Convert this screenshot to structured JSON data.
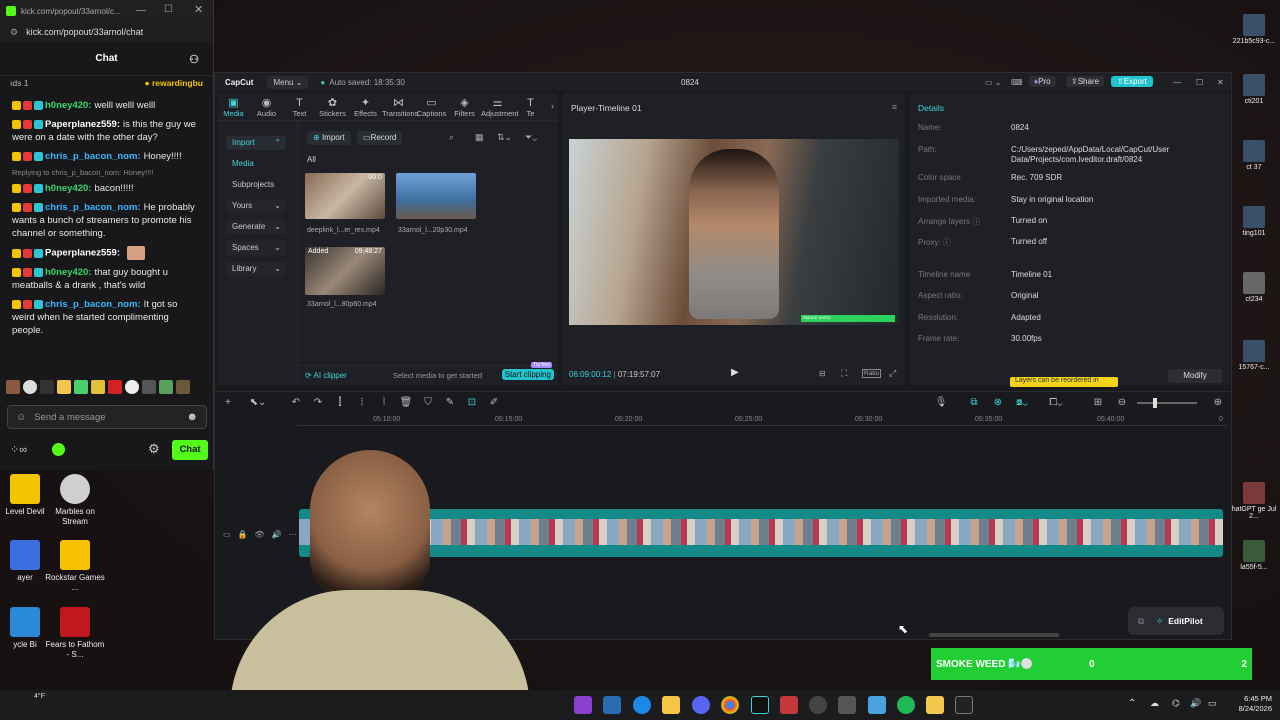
{
  "chat": {
    "tab_title": "kick.com/popout/33arnol/c...",
    "url": "kick.com/popout/33arnol/chat",
    "header": "Chat",
    "pinned_left": "ıds 1",
    "pinned_right": "rewardingbu",
    "messages": [
      {
        "user": "h0ney420:",
        "text": "welll welll welll",
        "color": "#3bd46b"
      },
      {
        "user": "Paperplanez559:",
        "text": "is this the guy we were on a date with the other day?",
        "color": "#ffffff"
      },
      {
        "user": "chris_p_bacon_nom:",
        "text": "Honey!!!!",
        "color": "#38b6ff"
      },
      {
        "reply": "Replying to chris_p_bacon_nom: Honey!!!!"
      },
      {
        "user": "h0ney420:",
        "text": "bacon!!!!!",
        "color": "#3bd46b"
      },
      {
        "user": "chris_p_bacon_nom:",
        "text": "He probably wants a bunch of streamers to promote his channel or something.",
        "color": "#38b6ff"
      },
      {
        "user": "Paperplanez559:",
        "text": "",
        "color": "#ffffff"
      },
      {
        "user": "h0ney420:",
        "text": "that guy bought u meatballs & a drank , that's wild",
        "color": "#3bd46b"
      },
      {
        "user": "chris_p_bacon_nom:",
        "text": "It got so weird when he started complimenting people.",
        "color": "#38b6ff"
      }
    ],
    "input_placeholder": "Send a message",
    "chat_button": "Chat"
  },
  "desktop": {
    "icons_left": [
      {
        "label": "Level Devil",
        "color": "#f2c400"
      },
      {
        "label": "Marbles on Stream",
        "color": "#cfcfcf"
      },
      {
        "label": "ayer",
        "color": "#3b6fe0"
      },
      {
        "label": "Rockstar Games ...",
        "color": "#f5c100"
      },
      {
        "label": "ycle Bi",
        "color": "#2a8ad9"
      },
      {
        "label": "Fears to Fathom - S...",
        "color": "#c0181e"
      }
    ],
    "icons_right": [
      {
        "label": "221b5c93-c..."
      },
      {
        "label": "cti201"
      },
      {
        "label": "ct 37"
      },
      {
        "label": "ting101"
      },
      {
        "label": "ct234"
      },
      {
        "label": "15767-c..."
      },
      {
        "label": "hatGPT ge Jul 2..."
      },
      {
        "label": "la55f-5..."
      }
    ],
    "weather": "4°F"
  },
  "capcut": {
    "logo": "CapCut",
    "menu": "Menu",
    "autosave": "Auto saved: 18:35:30",
    "project": "0824",
    "pro": "Pro",
    "share": "Share",
    "export": "Export",
    "tools": [
      {
        "label": "Media",
        "icon": "▣"
      },
      {
        "label": "Audio",
        "icon": "◉"
      },
      {
        "label": "Text",
        "icon": "T"
      },
      {
        "label": "Stickers",
        "icon": "✿"
      },
      {
        "label": "Effects",
        "icon": "✦"
      },
      {
        "label": "Transitions",
        "icon": "⋈"
      },
      {
        "label": "Captions",
        "icon": "▭"
      },
      {
        "label": "Filters",
        "icon": "◈"
      },
      {
        "label": "Adjustment",
        "icon": "⚌"
      },
      {
        "label": "Te",
        "icon": "T"
      }
    ],
    "side": {
      "import": "Import",
      "media": "Media",
      "subprojects": "Subprojects",
      "yours": "Yours",
      "generate": "Generate",
      "spaces": "Spaces",
      "library": "Library"
    },
    "media_bar": {
      "import": "Import",
      "record": "Record",
      "all": "All"
    },
    "media_items": [
      {
        "name": "deeplink_l...er_res.mp4",
        "duration": "00:0"
      },
      {
        "name": "33arnol_l...20p30.mp4",
        "duration": ""
      },
      {
        "name": "33arnol_l...80p60.mp4",
        "duration": "09:48:27",
        "tag": "Added"
      }
    ],
    "ai_clipper": "AI clipper",
    "select_hint": "Select media to get started",
    "start_clipping": "Start clipping",
    "try_free": "Try free",
    "player": {
      "title": "Player-Timeline 01",
      "current": "06:09:00:12",
      "total": "07:19:57:07",
      "ratio": "Ratio",
      "overlay_text": "SMOKE WEED"
    },
    "details": {
      "title": "Details",
      "rows": [
        {
          "k": "Name:",
          "v": "0824"
        },
        {
          "k": "Path:",
          "v": "C:/Users/zeped/AppData/Local/CapCut/User Data/Projects/com.lveditor.draft/0824"
        },
        {
          "k": "Color space",
          "v": "Rec. 709 SDR"
        },
        {
          "k": "Imported media:",
          "v": "Stay in original location"
        },
        {
          "k": "Arrange layers ⓘ",
          "v": "Turned on"
        },
        {
          "k": "Proxy: ⓘ",
          "v": "Turned off"
        },
        {
          "k": "Timeline name",
          "v": "Timeline 01"
        },
        {
          "k": "Aspect ratio:",
          "v": "Original"
        },
        {
          "k": "Resolution:",
          "v": "Adapted"
        },
        {
          "k": "Frame rate:",
          "v": "30.00fps"
        }
      ],
      "tooltip": "Layers can be reordered in",
      "modify": "Modify"
    },
    "ruler": [
      "05:10:00",
      "05:15:00",
      "05:20:00",
      "05:25:00",
      "05:30:00",
      "05:35:00",
      "05:40:00",
      "0"
    ],
    "editpilot": "EditPilot"
  },
  "overlay": {
    "label": "SMOKE WEED 🌬️⚪",
    "count": "0",
    "goal": "2"
  },
  "clock": {
    "time": "6:45 PM",
    "date": "8/24/2026"
  }
}
